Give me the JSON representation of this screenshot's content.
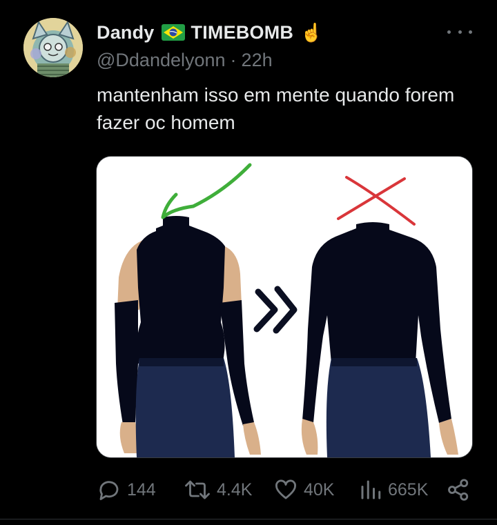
{
  "tweet": {
    "display_name": "Dandy",
    "name_suffix": "TIMEBOMB",
    "handle": "@Ddandelyonn",
    "separator": "·",
    "time": "22h",
    "text": "mantenham isso em mente quando forem fazer oc homem",
    "flag_icon": "brazil-flag-icon",
    "emoji": "☝️",
    "more_icon": "more-options-icon"
  },
  "actions": {
    "replies": {
      "icon": "reply-icon",
      "count": "144"
    },
    "retweets": {
      "icon": "retweet-icon",
      "count": "4.4K"
    },
    "likes": {
      "icon": "like-icon",
      "count": "40K"
    },
    "views": {
      "icon": "views-icon",
      "count": "665K"
    },
    "share": {
      "icon": "share-icon"
    }
  },
  "colors": {
    "background": "#000000",
    "text": "#e7e9ea",
    "muted": "#71767b",
    "check_green": "#3fae3a",
    "cross_red": "#d9363a"
  }
}
